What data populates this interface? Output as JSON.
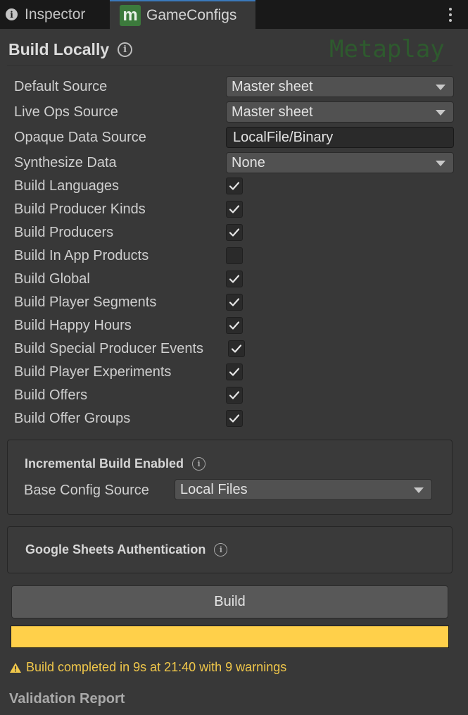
{
  "tabs": [
    {
      "label": "Inspector",
      "icon": "info-icon"
    },
    {
      "label": "GameConfigs",
      "icon": "metaplay-m-icon",
      "logo_letter": "m"
    }
  ],
  "header": {
    "title": "Build Locally",
    "brand": "Metaplay"
  },
  "settings": {
    "default_source": {
      "label": "Default Source",
      "value": "Master sheet"
    },
    "live_ops_source": {
      "label": "Live Ops Source",
      "value": "Master sheet"
    },
    "opaque_data_source": {
      "label": "Opaque Data Source",
      "value": "LocalFile/Binary"
    },
    "synthesize_data": {
      "label": "Synthesize Data",
      "value": "None"
    }
  },
  "checkboxes": [
    {
      "label": "Build Languages",
      "checked": true
    },
    {
      "label": "Build Producer Kinds",
      "checked": true
    },
    {
      "label": "Build Producers",
      "checked": true
    },
    {
      "label": "Build In App Products",
      "checked": false
    },
    {
      "label": "Build Global",
      "checked": true
    },
    {
      "label": "Build Player Segments",
      "checked": true
    },
    {
      "label": "Build Happy Hours",
      "checked": true
    },
    {
      "label": "Build Special Producer Events",
      "checked": true
    },
    {
      "label": "Build Player Experiments",
      "checked": true
    },
    {
      "label": "Build Offers",
      "checked": true
    },
    {
      "label": "Build Offer Groups",
      "checked": true
    }
  ],
  "incremental": {
    "title": "Incremental Build Enabled",
    "base_config_label": "Base Config Source",
    "base_config_value": "Local Files"
  },
  "google_auth": {
    "title": "Google Sheets Authentication"
  },
  "build_button": "Build",
  "progress": {
    "fraction": 1.0,
    "color": "#ffd04a"
  },
  "status": {
    "text": "Build completed in 9s at 21:40 with 9 warnings",
    "color": "#f0c74a"
  },
  "validation_title": "Validation Report"
}
